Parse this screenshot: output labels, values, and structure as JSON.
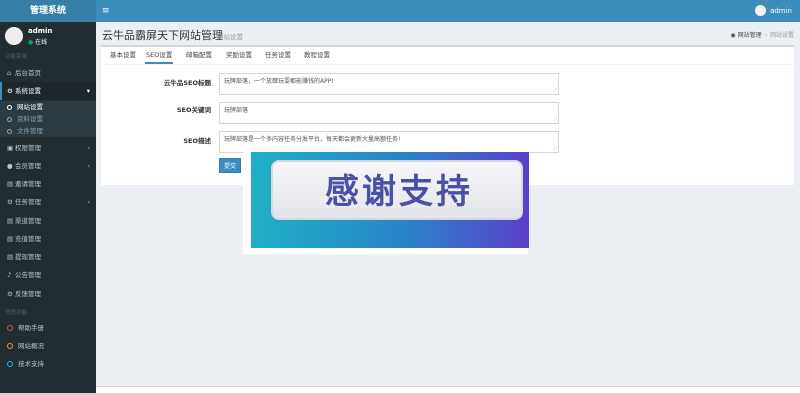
{
  "brand": "管理系统",
  "topbar": {
    "toggle_icon": "menu-icon",
    "username": "admin"
  },
  "sidebar": {
    "user": {
      "name": "admin",
      "status": "在线"
    },
    "section_main": "功能菜单",
    "section_other": "其他功能",
    "items": [
      {
        "label": "后台首页",
        "icon": "home-icon"
      },
      {
        "label": "系统设置",
        "icon": "gear-icon",
        "chevron": "▾"
      },
      {
        "label": "权限管理",
        "icon": "lock-icon",
        "chevron": "‹"
      },
      {
        "label": "会员管理",
        "icon": "users-icon",
        "chevron": "‹"
      },
      {
        "label": "邀请管理",
        "icon": "list-icon"
      },
      {
        "label": "任务管理",
        "icon": "gear-icon",
        "chevron": "‹"
      },
      {
        "label": "渠道管理",
        "icon": "list-icon"
      },
      {
        "label": "充值管理",
        "icon": "list-icon"
      },
      {
        "label": "提现管理",
        "icon": "list-icon"
      },
      {
        "label": "公告管理",
        "icon": "bell-icon"
      },
      {
        "label": "反馈管理",
        "icon": "gear-icon"
      }
    ],
    "sub_items": [
      {
        "label": "网站设置"
      },
      {
        "label": "资料设置"
      },
      {
        "label": "文件管理"
      }
    ],
    "misc": [
      {
        "label": "帮助手册",
        "color": "#dd4b39"
      },
      {
        "label": "网站概况",
        "color": "#f39c12"
      },
      {
        "label": "技术支持",
        "color": "#00c0ef"
      }
    ]
  },
  "header": {
    "title": "云牛品霸屏天下网站管理",
    "subtitle": "网站设置",
    "breadcrumb": [
      "网站管理",
      "网站设置"
    ]
  },
  "tabs": [
    "基本设置",
    "SEO设置",
    "邮箱配置",
    "奖励设置",
    "任务设置",
    "教程设置"
  ],
  "form": {
    "seo_title_label": "云牛品SEO标题",
    "seo_title_value": "玩牌部落，一个放肆玩耍都能赚钱的APP!",
    "seo_keywords_label": "SEO关键词",
    "seo_keywords_value": "玩牌部落",
    "seo_desc_label": "SEO描述",
    "seo_desc_value": "玩牌部落是一个多内容任务分发平台，每天都会更新大量高额任务!",
    "submit_label": "提交"
  },
  "banner": {
    "text": "感谢支持"
  },
  "colors": {
    "primary": "#3c8dbc",
    "sidebar": "#222d32",
    "logo": "#367fa9"
  }
}
